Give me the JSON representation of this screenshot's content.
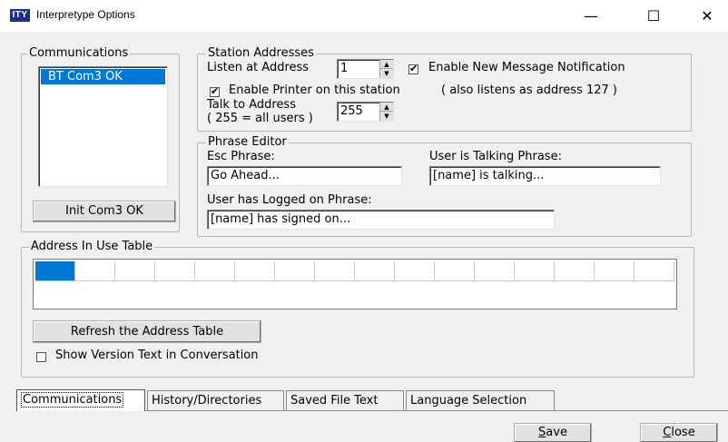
{
  "window": {
    "icon_text": "ITY",
    "title": "Interpretype Options",
    "minimize": "—",
    "maximize": "☐",
    "close": "✕"
  },
  "communications": {
    "group_label": "Communications",
    "list_items": [
      "BT Com3 OK"
    ],
    "init_button": "Init Com3 OK"
  },
  "station": {
    "group_label": "Station Addresses",
    "listen_label": "Listen at Address",
    "listen_value": "1",
    "enable_notification_label": "Enable New Message Notification",
    "enable_notification_checked": true,
    "enable_printer_label": "Enable Printer on this station",
    "printer_note": "( also listens as address 127 )",
    "enable_printer_checked": true,
    "talk_label_1": "Talk to Address",
    "talk_label_2": "( 255 = all users )",
    "talk_value": "255"
  },
  "phrase_editor": {
    "group_label": "Phrase Editor",
    "esc_label": "Esc Phrase:",
    "esc_value": "Go Ahead...",
    "talking_label": "User is Talking Phrase:",
    "talking_value": "[name] is talking...",
    "logged_label": "User has Logged on Phrase:",
    "logged_value": "[name] has signed on..."
  },
  "address_table": {
    "group_label": "Address In Use Table",
    "cells": 16,
    "selected_cell": 0,
    "refresh_button": "Refresh the Address Table",
    "show_version_label": "Show Version Text in Conversation",
    "show_version_checked": false
  },
  "tabs": [
    "Communications",
    "History/Directories",
    "Saved File Text",
    "Language Selection"
  ],
  "active_tab": 0,
  "footer": {
    "save_button": "Save",
    "close_button": "Close"
  },
  "colors": {
    "selection": "#0078d7",
    "icon_bg": "#1d2e8f",
    "dialog_bg": "#f0f0f0"
  }
}
